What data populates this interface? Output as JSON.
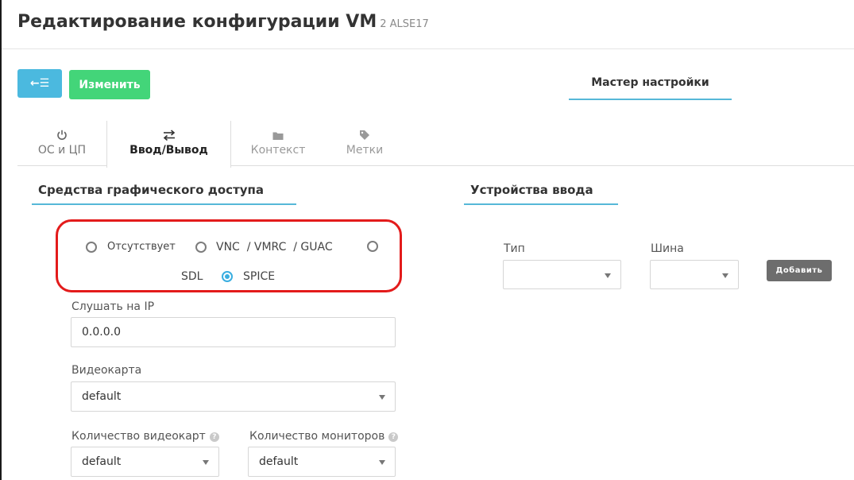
{
  "header": {
    "title": "Редактирование конфигурации VM",
    "subtitle": "2 ALSE17"
  },
  "toolbar": {
    "back_icon": "arrow-left-list-icon",
    "back_label": "←☰",
    "save_label": "Изменить",
    "wizard_label": "Мастер настройки"
  },
  "tabs": [
    {
      "icon": "power-icon",
      "label": "ОС и ЦП"
    },
    {
      "icon": "arrows-exchange-icon",
      "label": "Ввод/Вывод"
    },
    {
      "icon": "folder-icon",
      "label": "Контекст"
    },
    {
      "icon": "tag-icon",
      "label": "Метки"
    }
  ],
  "graphics": {
    "title": "Средства графического доступа",
    "options": [
      {
        "label": "Отсутствует",
        "checked": false
      },
      {
        "label": "VNC  / VMRC  / GUAC",
        "checked": false
      },
      {
        "label": "SDL",
        "checked": false
      },
      {
        "label": "SPICE",
        "checked": true
      }
    ],
    "listen_ip_label": "Слушать на IP",
    "listen_ip_value": "0.0.0.0",
    "videocard_label": "Видеокарта",
    "videocard_value": "default",
    "videocard_count_label": "Количество видеокарт",
    "videocard_count_value": "default",
    "monitor_count_label": "Количество мониторов",
    "monitor_count_value": "default"
  },
  "input_devices": {
    "title": "Устройства ввода",
    "type_label": "Тип",
    "type_value": "",
    "bus_label": "Шина",
    "bus_value": "",
    "add_label": "Добавить"
  },
  "colors": {
    "accent": "#56b8d8",
    "back_button": "#4bb9df",
    "save_button": "#43d579",
    "highlight_border": "#e31b1b",
    "add_button": "#6d6d6d"
  }
}
